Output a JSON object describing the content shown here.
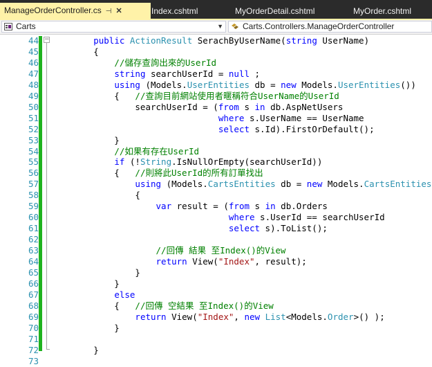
{
  "tabs": [
    {
      "label": "ManageOrderController.cs",
      "active": true
    },
    {
      "label": "Index.cshtml",
      "active": false
    },
    {
      "label": "MyOrderDetail.cshtml",
      "active": false
    },
    {
      "label": "MyOrder.cshtml",
      "active": false
    }
  ],
  "nav": {
    "project": "Carts",
    "member": "Carts.Controllers.ManageOrderController"
  },
  "colors": {
    "keyword": "#0000ff",
    "type": "#2b91af",
    "comment": "#008000",
    "string": "#a31515",
    "line_number": "#2b91af",
    "active_tab": "#fff2a8",
    "change_bar": "#1fb31f"
  },
  "lines": [
    {
      "n": "44",
      "t": [
        [
          "        ",
          ""
        ],
        [
          "public ",
          "kw"
        ],
        [
          "ActionResult",
          "ty"
        ],
        [
          " SerachByUserName(",
          ""
        ],
        [
          "string",
          "kw"
        ],
        [
          " UserName)",
          ""
        ]
      ]
    },
    {
      "n": "45",
      "t": [
        [
          "        {",
          ""
        ]
      ]
    },
    {
      "n": "46",
      "t": [
        [
          "            ",
          ""
        ],
        [
          "//儲存查詢出來的UserId",
          "cm"
        ]
      ]
    },
    {
      "n": "47",
      "t": [
        [
          "            ",
          ""
        ],
        [
          "string",
          "kw"
        ],
        [
          " searchUserId = ",
          ""
        ],
        [
          "null",
          "kw"
        ],
        [
          " ;",
          ""
        ]
      ]
    },
    {
      "n": "48",
      "t": [
        [
          "            ",
          ""
        ],
        [
          "using",
          "kw"
        ],
        [
          " (Models.",
          ""
        ],
        [
          "UserEntities",
          "ty"
        ],
        [
          " db = ",
          ""
        ],
        [
          "new",
          "kw"
        ],
        [
          " Models.",
          ""
        ],
        [
          "UserEntities",
          "ty"
        ],
        [
          "())",
          ""
        ]
      ]
    },
    {
      "n": "49",
      "t": [
        [
          "            {   ",
          ""
        ],
        [
          "//查詢目前網站使用者暱稱符合UserName的UserId",
          "cm"
        ]
      ]
    },
    {
      "n": "50",
      "t": [
        [
          "                searchUserId = (",
          ""
        ],
        [
          "from",
          "kw"
        ],
        [
          " s ",
          ""
        ],
        [
          "in",
          "kw"
        ],
        [
          " db.AspNetUsers",
          ""
        ]
      ]
    },
    {
      "n": "51",
      "t": [
        [
          "                                ",
          ""
        ],
        [
          "where",
          "kw"
        ],
        [
          " s.UserName == UserName",
          ""
        ]
      ]
    },
    {
      "n": "52",
      "t": [
        [
          "                                ",
          ""
        ],
        [
          "select",
          "kw"
        ],
        [
          " s.Id).FirstOrDefault();",
          ""
        ]
      ]
    },
    {
      "n": "53",
      "t": [
        [
          "            }",
          ""
        ]
      ]
    },
    {
      "n": "54",
      "t": [
        [
          "            ",
          ""
        ],
        [
          "//如果有存在UserId",
          "cm"
        ]
      ]
    },
    {
      "n": "55",
      "t": [
        [
          "            ",
          ""
        ],
        [
          "if",
          "kw"
        ],
        [
          " (!",
          ""
        ],
        [
          "String",
          "ty"
        ],
        [
          ".IsNullOrEmpty(searchUserId))",
          ""
        ]
      ]
    },
    {
      "n": "56",
      "t": [
        [
          "            {   ",
          ""
        ],
        [
          "//則將此UserId的所有訂單找出",
          "cm"
        ]
      ]
    },
    {
      "n": "57",
      "t": [
        [
          "                ",
          ""
        ],
        [
          "using",
          "kw"
        ],
        [
          " (Models.",
          ""
        ],
        [
          "CartsEntities",
          "ty"
        ],
        [
          " db = ",
          ""
        ],
        [
          "new",
          "kw"
        ],
        [
          " Models.",
          ""
        ],
        [
          "CartsEntities",
          "ty"
        ],
        [
          "())",
          ""
        ]
      ]
    },
    {
      "n": "58",
      "t": [
        [
          "                {",
          ""
        ]
      ]
    },
    {
      "n": "59",
      "t": [
        [
          "                    ",
          ""
        ],
        [
          "var",
          "kw"
        ],
        [
          " result = (",
          ""
        ],
        [
          "from",
          "kw"
        ],
        [
          " s ",
          ""
        ],
        [
          "in",
          "kw"
        ],
        [
          " db.Orders",
          ""
        ]
      ]
    },
    {
      "n": "60",
      "t": [
        [
          "                                  ",
          ""
        ],
        [
          "where",
          "kw"
        ],
        [
          " s.UserId == searchUserId",
          ""
        ]
      ]
    },
    {
      "n": "61",
      "t": [
        [
          "                                  ",
          ""
        ],
        [
          "select",
          "kw"
        ],
        [
          " s).ToList();",
          ""
        ]
      ]
    },
    {
      "n": "62",
      "t": [
        [
          "",
          ""
        ]
      ]
    },
    {
      "n": "63",
      "t": [
        [
          "                    ",
          ""
        ],
        [
          "//回傳 結果 至Index()的View",
          "cm"
        ]
      ]
    },
    {
      "n": "64",
      "t": [
        [
          "                    ",
          ""
        ],
        [
          "return",
          "kw"
        ],
        [
          " View(",
          ""
        ],
        [
          "\"Index\"",
          "st"
        ],
        [
          ", result);",
          ""
        ]
      ]
    },
    {
      "n": "65",
      "t": [
        [
          "                }",
          ""
        ]
      ]
    },
    {
      "n": "66",
      "t": [
        [
          "            }",
          ""
        ]
      ]
    },
    {
      "n": "67",
      "t": [
        [
          "            ",
          ""
        ],
        [
          "else",
          "kw"
        ]
      ]
    },
    {
      "n": "68",
      "t": [
        [
          "            {   ",
          ""
        ],
        [
          "//回傳 空結果 至Index()的View",
          "cm"
        ]
      ]
    },
    {
      "n": "69",
      "t": [
        [
          "                ",
          ""
        ],
        [
          "return",
          "kw"
        ],
        [
          " View(",
          ""
        ],
        [
          "\"Index\"",
          "st"
        ],
        [
          ", ",
          ""
        ],
        [
          "new",
          "kw"
        ],
        [
          " ",
          ""
        ],
        [
          "List",
          "ty"
        ],
        [
          "<Models.",
          ""
        ],
        [
          "Order",
          "ty"
        ],
        [
          ">() );",
          ""
        ]
      ]
    },
    {
      "n": "70",
      "t": [
        [
          "            }",
          ""
        ]
      ]
    },
    {
      "n": "71",
      "t": [
        [
          "",
          ""
        ]
      ]
    },
    {
      "n": "72",
      "t": [
        [
          "        }",
          ""
        ]
      ]
    },
    {
      "n": "73",
      "t": [
        [
          "",
          ""
        ]
      ]
    }
  ]
}
